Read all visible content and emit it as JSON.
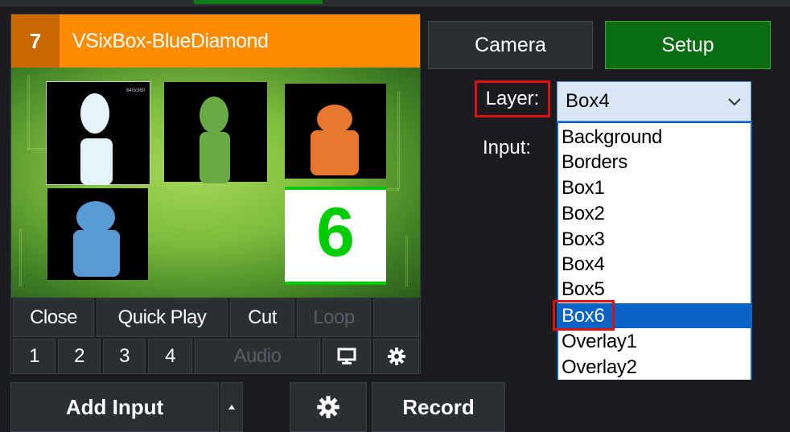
{
  "input": {
    "number": "7",
    "title": "VSixBox-BlueDiamond",
    "tiny_label": "640x360",
    "box6_number": "6"
  },
  "controls": {
    "close": "Close",
    "quick_play": "Quick Play",
    "cut": "Cut",
    "loop": "Loop",
    "bus1": "1",
    "bus2": "2",
    "bus3": "3",
    "bus4": "4",
    "audio": "Audio"
  },
  "right_panel": {
    "camera": "Camera",
    "setup": "Setup",
    "layer_label": "Layer:",
    "input_label": "Input:",
    "layer_selected": "Box4",
    "layer_options": [
      "Background",
      "Borders",
      "Box1",
      "Box2",
      "Box3",
      "Box4",
      "Box5",
      "Box6",
      "Overlay1",
      "Overlay2"
    ],
    "highlighted_option": "Box6"
  },
  "bottom": {
    "add_input": "Add Input",
    "record": "Record"
  },
  "icons": {
    "chevron": "chevron-down-icon",
    "monitor": "monitor-icon",
    "gear": "gear-icon",
    "caret": "caret-up-icon"
  },
  "colors": {
    "header_orange": "#ff8c00",
    "setup_green": "#0b6d12",
    "selection_blue": "#0a64c8",
    "highlight_red": "#e01010"
  }
}
